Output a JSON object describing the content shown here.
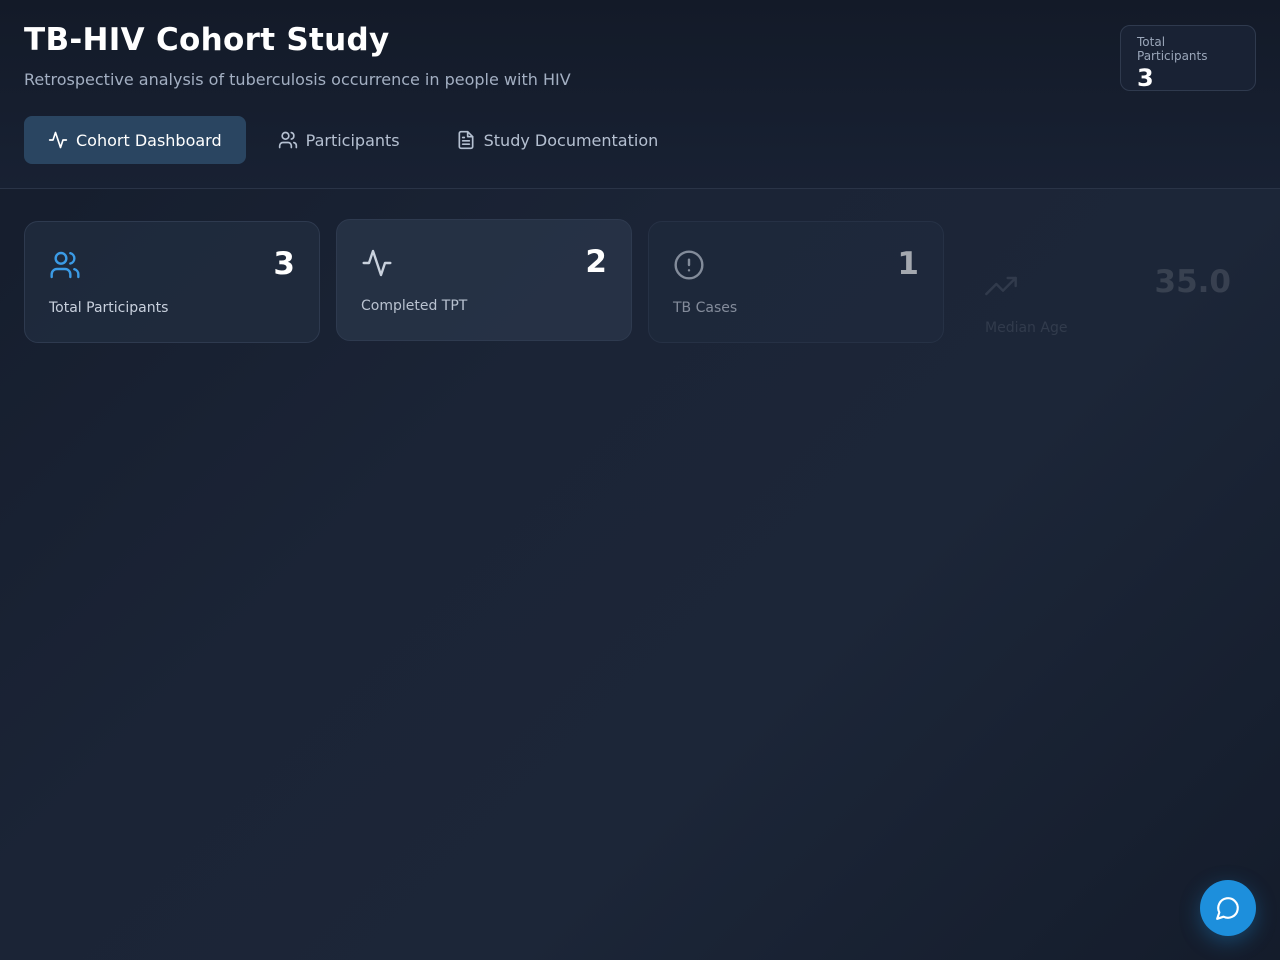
{
  "header": {
    "title": "TB-HIV Cohort Study",
    "subtitle": "Retrospective analysis of tuberculosis occurrence in people with HIV",
    "total_badge": {
      "label": "Total Participants",
      "value": "3"
    }
  },
  "tabs": [
    {
      "label": "Cohort Dashboard",
      "icon": "activity-icon",
      "active": true
    },
    {
      "label": "Participants",
      "icon": "users-icon",
      "active": false
    },
    {
      "label": "Study Documentation",
      "icon": "document-icon",
      "active": false
    }
  ],
  "stats": [
    {
      "label": "Total Participants",
      "value": "3",
      "icon": "users-icon",
      "color": "#3b9be6"
    },
    {
      "label": "Completed TPT",
      "value": "2",
      "icon": "activity-icon",
      "color": "#c9d1dd"
    },
    {
      "label": "TB Cases",
      "value": "1",
      "icon": "alert-circle-icon",
      "color": "#c9d1dd"
    },
    {
      "label": "Median Age",
      "value": "35.0",
      "icon": "trend-icon",
      "color": "#c9d1dd"
    }
  ],
  "chat": {
    "icon": "chat-bubble-icon",
    "color": "#1d8fdc"
  }
}
